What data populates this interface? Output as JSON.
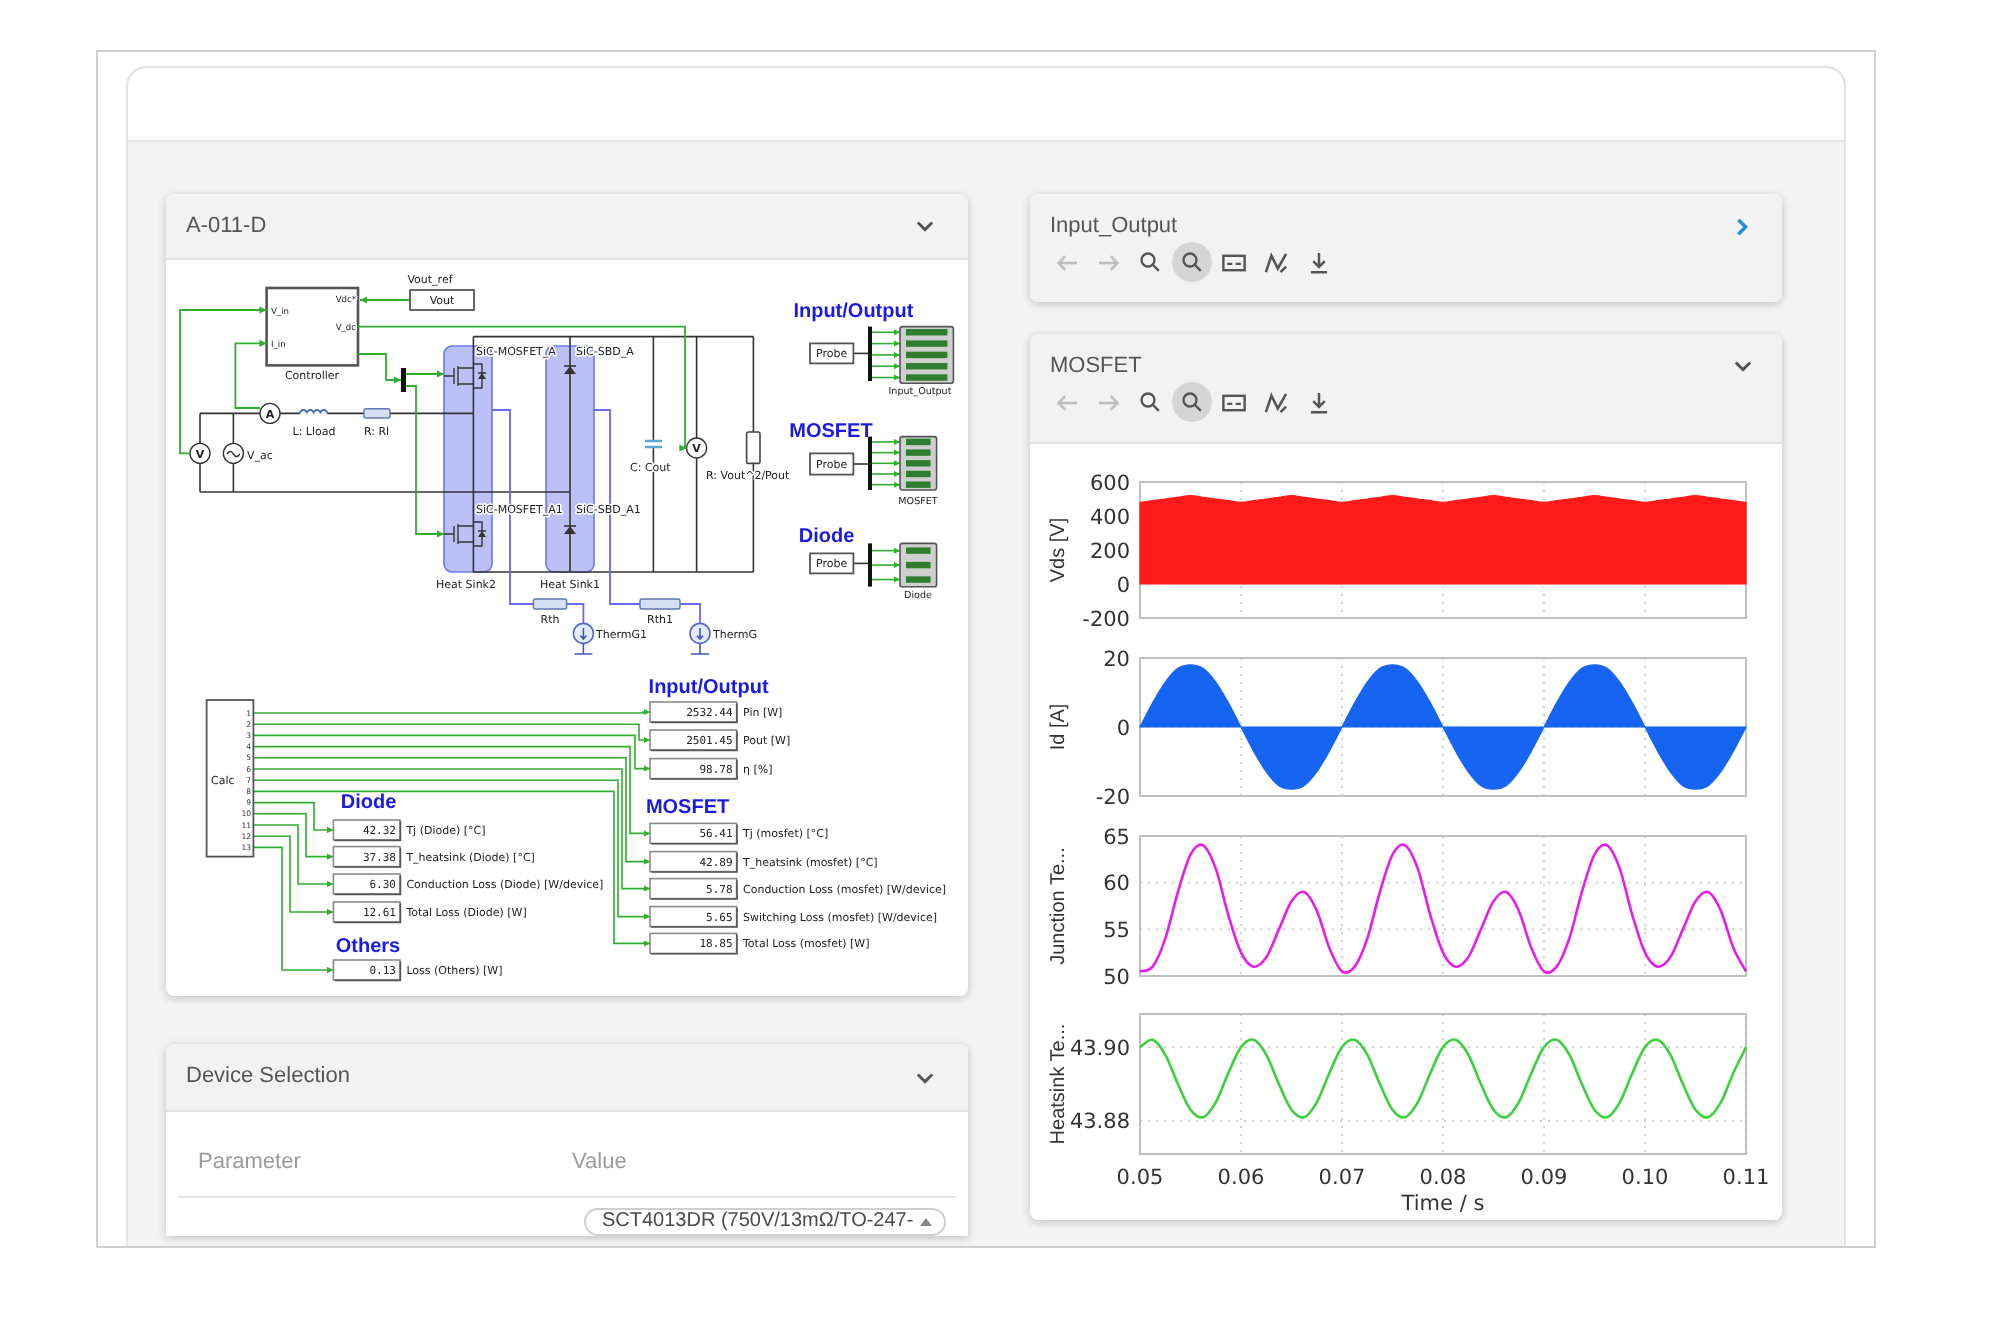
{
  "schematic_panel": {
    "title": "A-011-D",
    "expanded": true,
    "circuit": {
      "labels": [
        {
          "kind": "label",
          "text": "Vout_ref"
        },
        {
          "kind": "port",
          "text": "V_in"
        },
        {
          "kind": "port",
          "text": "I_in"
        },
        {
          "kind": "port",
          "text": "Vdc*"
        },
        {
          "kind": "port",
          "text": "V_dc"
        },
        {
          "kind": "label",
          "text": "Controller"
        },
        {
          "kind": "meter",
          "text": "A"
        },
        {
          "kind": "label",
          "text": "L: Lload"
        },
        {
          "kind": "label",
          "text": "R: Rl"
        },
        {
          "kind": "meter",
          "text": "V"
        },
        {
          "kind": "label",
          "text": "V_ac"
        },
        {
          "kind": "label",
          "text": "SiC-MOSFET_A"
        },
        {
          "kind": "label",
          "text": "SiC-SBD_A"
        },
        {
          "kind": "label",
          "text": "SiC-MOSFET_A1"
        },
        {
          "kind": "label",
          "text": "SiC-SBD_A1"
        },
        {
          "kind": "label",
          "text": "C: Cout"
        },
        {
          "kind": "meter",
          "text": "V"
        },
        {
          "kind": "label",
          "text": "R: Vout^2/Pout"
        },
        {
          "kind": "label",
          "text": "Heat Sink2"
        },
        {
          "kind": "label",
          "text": "Heat Sink1"
        },
        {
          "kind": "label",
          "text": "Rth"
        },
        {
          "kind": "label",
          "text": "Rth1"
        },
        {
          "kind": "label",
          "text": "ThermG1"
        },
        {
          "kind": "label",
          "text": "ThermG"
        }
      ],
      "source_block": {
        "text": "Vout"
      },
      "scopes": [
        {
          "heading": "Input/Output",
          "probe": "Probe",
          "label": "Input_Output"
        },
        {
          "heading": "MOSFET",
          "probe": "Probe",
          "label": "MOSFET"
        },
        {
          "heading": "Diode",
          "probe": "Probe",
          "label": "Diode"
        }
      ]
    },
    "calc_block": {
      "label": "Calc",
      "pins": [
        "1",
        "2",
        "3",
        "4",
        "5",
        "6",
        "7",
        "8",
        "9",
        "10",
        "11",
        "12",
        "13"
      ]
    },
    "display_groups": [
      {
        "heading": "Input/Output",
        "displays": [
          {
            "value": "2532.44",
            "label": "Pin [W]"
          },
          {
            "value": "2501.45",
            "label": "Pout [W]"
          },
          {
            "value": "98.78",
            "label": "η [%]"
          }
        ]
      },
      {
        "heading": "Diode",
        "displays": [
          {
            "value": "42.32",
            "label": "Tj (Diode) [°C]"
          },
          {
            "value": "37.38",
            "label": "T_heatsink (Diode) [°C]"
          },
          {
            "value": "6.30",
            "label": "Conduction Loss (Diode) [W/device]"
          },
          {
            "value": "12.61",
            "label": "Total Loss (Diode) [W]"
          }
        ]
      },
      {
        "heading": "MOSFET",
        "displays": [
          {
            "value": "56.41",
            "label": "Tj (mosfet) [°C]"
          },
          {
            "value": "42.89",
            "label": "T_heatsink (mosfet) [°C]"
          },
          {
            "value": "5.78",
            "label": "Conduction Loss (mosfet) [W/device]"
          },
          {
            "value": "5.65",
            "label": "Switching Loss (mosfet) [W/device]"
          },
          {
            "value": "18.85",
            "label": "Total Loss (mosfet) [W]"
          }
        ]
      },
      {
        "heading": "Others",
        "displays": [
          {
            "value": "0.13",
            "label": "Loss (Others) [W]"
          }
        ]
      }
    ]
  },
  "device_selection_panel": {
    "title": "Device Selection",
    "expanded": true,
    "table": {
      "columns": [
        "Parameter",
        "Value"
      ],
      "rows": [
        {
          "value": "SCT4013DR (750V/13mΩ/TO-247-"
        }
      ]
    }
  },
  "input_output_panel": {
    "title": "Input_Output",
    "expanded": false,
    "toolbar": [
      {
        "kind": "back",
        "selected": false,
        "disabled": true
      },
      {
        "kind": "forward",
        "selected": false,
        "disabled": true
      },
      {
        "kind": "zoom",
        "selected": false,
        "disabled": false
      },
      {
        "kind": "zoom_rect",
        "selected": true,
        "disabled": false
      },
      {
        "kind": "subplots",
        "selected": false,
        "disabled": false
      },
      {
        "kind": "curve",
        "selected": false,
        "disabled": false
      },
      {
        "kind": "save",
        "selected": false,
        "disabled": false
      }
    ]
  },
  "mosfet_panel": {
    "title": "MOSFET",
    "expanded": true,
    "toolbar": [
      {
        "kind": "back",
        "selected": false,
        "disabled": true
      },
      {
        "kind": "forward",
        "selected": false,
        "disabled": true
      },
      {
        "kind": "zoom",
        "selected": false,
        "disabled": false
      },
      {
        "kind": "zoom_rect",
        "selected": true,
        "disabled": false
      },
      {
        "kind": "subplots",
        "selected": false,
        "disabled": false
      },
      {
        "kind": "curve",
        "selected": false,
        "disabled": false
      },
      {
        "kind": "save",
        "selected": false,
        "disabled": false
      }
    ],
    "plots": [
      {
        "chart_data": {
          "type": "area",
          "ylabel": "Vds [V]",
          "x": [
            0.05,
            0.05125,
            0.0525,
            0.05375,
            0.055,
            0.05625,
            0.0575,
            0.05875,
            0.06,
            0.06125,
            0.0625,
            0.06375,
            0.065,
            0.06625,
            0.0675,
            0.06875,
            0.07,
            0.07125,
            0.0725,
            0.07375,
            0.075,
            0.07625,
            0.0775,
            0.07875,
            0.08,
            0.08125,
            0.0825,
            0.08375,
            0.085,
            0.08625,
            0.0875,
            0.08875,
            0.09,
            0.09125,
            0.0925,
            0.09375,
            0.095,
            0.09625,
            0.0975,
            0.09875,
            0.1,
            0.10125,
            0.1025,
            0.10375,
            0.105,
            0.10625,
            0.1075,
            0.10875,
            0.11
          ],
          "series": [
            {
              "color": "#ff1a1a",
              "values": [
                480,
                490,
                500,
                510,
                520,
                510,
                500,
                490,
                480,
                490,
                500,
                510,
                520,
                510,
                500,
                490,
                480,
                490,
                500,
                510,
                520,
                510,
                500,
                490,
                480,
                490,
                500,
                510,
                520,
                510,
                500,
                490,
                480,
                490,
                500,
                510,
                520,
                510,
                500,
                490,
                480,
                490,
                500,
                510,
                520,
                510,
                500,
                490,
                480
              ]
            }
          ],
          "xlim": [
            0.05,
            0.11
          ],
          "ylim": [
            -200,
            600
          ],
          "yticks": [
            -200,
            0,
            200,
            400,
            600
          ],
          "grid": true
        }
      },
      {
        "chart_data": {
          "type": "area",
          "ylabel": "Id [A]",
          "x": [
            0.05,
            0.05125,
            0.0525,
            0.05375,
            0.055,
            0.05625,
            0.0575,
            0.05875,
            0.06,
            0.06125,
            0.0625,
            0.06375,
            0.065,
            0.06625,
            0.0675,
            0.06875,
            0.07,
            0.07125,
            0.0725,
            0.07375,
            0.075,
            0.07625,
            0.0775,
            0.07875,
            0.08,
            0.08125,
            0.0825,
            0.08375,
            0.085,
            0.08625,
            0.0875,
            0.08875,
            0.09,
            0.09125,
            0.0925,
            0.09375,
            0.095,
            0.09625,
            0.0975,
            0.09875,
            0.1,
            0.10125,
            0.1025,
            0.10375,
            0.105,
            0.10625,
            0.1075,
            0.10875,
            0.11
          ],
          "series": [
            {
              "color": "#1664f2",
              "values": [
                0,
                7,
                13,
                17,
                18,
                17,
                13,
                7,
                0,
                -7,
                -13,
                -17,
                -18,
                -17,
                -13,
                -7,
                0,
                7,
                13,
                17,
                18,
                17,
                13,
                7,
                0,
                -7,
                -13,
                -17,
                -18,
                -17,
                -13,
                -7,
                0,
                7,
                13,
                17,
                18,
                17,
                13,
                7,
                0,
                -7,
                -13,
                -17,
                -18,
                -17,
                -13,
                -7,
                0
              ]
            }
          ],
          "xlim": [
            0.05,
            0.11
          ],
          "ylim": [
            -20,
            20
          ],
          "yticks": [
            -20,
            0,
            20
          ],
          "grid": true
        }
      },
      {
        "chart_data": {
          "type": "line",
          "ylabel": "Junction Te...",
          "x": [
            0.05,
            0.05125,
            0.0525,
            0.05375,
            0.055,
            0.05625,
            0.0575,
            0.05875,
            0.06,
            0.06125,
            0.0625,
            0.06375,
            0.065,
            0.06625,
            0.0675,
            0.06875,
            0.07,
            0.07125,
            0.0725,
            0.07375,
            0.075,
            0.07625,
            0.0775,
            0.07875,
            0.08,
            0.08125,
            0.0825,
            0.08375,
            0.085,
            0.08625,
            0.0875,
            0.08875,
            0.09,
            0.09125,
            0.0925,
            0.09375,
            0.095,
            0.09625,
            0.0975,
            0.09875,
            0.1,
            0.10125,
            0.1025,
            0.10375,
            0.105,
            0.10625,
            0.1075,
            0.10875,
            0.11
          ],
          "series": [
            {
              "color": "#e61ee6",
              "values": [
                50.5,
                51,
                54,
                59,
                63,
                64,
                61.5,
                56.5,
                52.5,
                51,
                52,
                55,
                58,
                59,
                57,
                53,
                50.5,
                51,
                54,
                59,
                63,
                64,
                61.5,
                56.5,
                52.5,
                51,
                52,
                55,
                58,
                59,
                57,
                53,
                50.5,
                51,
                54,
                59,
                63,
                64,
                61.5,
                56.5,
                52.5,
                51,
                52,
                55,
                58,
                59,
                57,
                53,
                50.5
              ]
            }
          ],
          "xlim": [
            0.05,
            0.11
          ],
          "ylim": [
            50,
            65
          ],
          "yticks": [
            50,
            55,
            60,
            65
          ],
          "grid": true
        }
      },
      {
        "chart_data": {
          "type": "line",
          "xlabel": "Time / s",
          "ylabel": "Heatsink Te...",
          "x": [
            0.05,
            0.05125,
            0.0525,
            0.05375,
            0.055,
            0.05625,
            0.0575,
            0.05875,
            0.06,
            0.06125,
            0.0625,
            0.06375,
            0.065,
            0.06625,
            0.0675,
            0.06875,
            0.07,
            0.07125,
            0.0725,
            0.07375,
            0.075,
            0.07625,
            0.0775,
            0.07875,
            0.08,
            0.08125,
            0.0825,
            0.08375,
            0.085,
            0.08625,
            0.0875,
            0.08875,
            0.09,
            0.09125,
            0.0925,
            0.09375,
            0.095,
            0.09625,
            0.0975,
            0.09875,
            0.1,
            0.10125,
            0.1025,
            0.10375,
            0.105,
            0.10625,
            0.1075,
            0.10875,
            0.11
          ],
          "series": [
            {
              "color": "#3ecf3e",
              "values": [
                43.9,
                43.902,
                43.898,
                43.89,
                43.883,
                43.881,
                43.885,
                43.893,
                43.9,
                43.902,
                43.898,
                43.89,
                43.883,
                43.881,
                43.885,
                43.893,
                43.9,
                43.902,
                43.898,
                43.89,
                43.883,
                43.881,
                43.885,
                43.893,
                43.9,
                43.902,
                43.898,
                43.89,
                43.883,
                43.881,
                43.885,
                43.893,
                43.9,
                43.902,
                43.898,
                43.89,
                43.883,
                43.881,
                43.885,
                43.893,
                43.9,
                43.902,
                43.898,
                43.89,
                43.883,
                43.881,
                43.885,
                43.893,
                43.9
              ]
            }
          ],
          "xlim": [
            0.05,
            0.11
          ],
          "ylim": [
            43.871,
            43.909
          ],
          "xticks": [
            {
              "value": 0.05,
              "label": "0.05"
            },
            {
              "value": 0.06,
              "label": "0.06"
            },
            {
              "value": 0.07,
              "label": "0.07"
            },
            {
              "value": 0.08,
              "label": "0.08"
            },
            {
              "value": 0.09,
              "label": "0.09"
            },
            {
              "value": 0.1,
              "label": "0.10"
            },
            {
              "value": 0.11,
              "label": "0.11"
            }
          ],
          "yticks": [
            {
              "value": 43.88,
              "label": "43.88"
            },
            {
              "value": 43.9,
              "label": "43.90"
            }
          ],
          "grid": true
        }
      }
    ]
  }
}
